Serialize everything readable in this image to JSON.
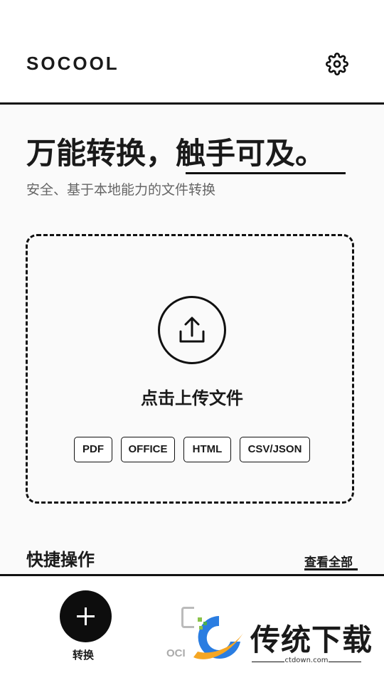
{
  "header": {
    "brand": "SOCOOL",
    "settings_icon": "gear-icon"
  },
  "hero": {
    "headline": "万能转换，触手可及。",
    "subtitle": "安全、基于本地能力的文件转换"
  },
  "upload": {
    "icon": "upload-icon",
    "title": "点击上传文件",
    "formats": [
      "PDF",
      "OFFICE",
      "HTML",
      "CSV/JSON"
    ]
  },
  "quick_actions": {
    "title": "快捷操作",
    "view_all": "查看全部"
  },
  "bottom_nav": {
    "items": [
      {
        "label": "转换",
        "icon": "plus-icon",
        "active": true
      },
      {
        "label": "OCI",
        "icon": "ocr-icon",
        "active": false
      }
    ]
  },
  "watermark": {
    "text": "传统下载",
    "url": "ctdown.com"
  },
  "colors": {
    "text": "#1a1a1a",
    "muted": "#666666",
    "inactive": "#aaaaaa",
    "fab": "#0d0d0d"
  }
}
